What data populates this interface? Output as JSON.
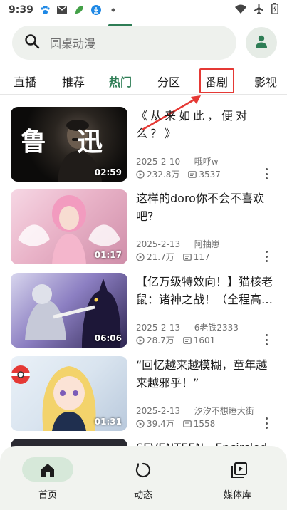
{
  "status_bar": {
    "time": "9:39"
  },
  "search": {
    "placeholder": "圆桌动漫"
  },
  "tabs": [
    "直播",
    "推荐",
    "热门",
    "分区",
    "番剧",
    "影视"
  ],
  "active_tab": "热门",
  "cards": [
    {
      "title": "《从来如此，便对么？》",
      "duration": "02:59",
      "date": "2025-2-10",
      "author": "哦呼w",
      "views": "232.8万",
      "comments": "3537",
      "thumb_text": "鲁  迅"
    },
    {
      "title": "这样的doro你不会不喜欢吧?",
      "duration": "01:17",
      "date": "2025-2-13",
      "author": "阿抽崽",
      "views": "21.7万",
      "comments": "117"
    },
    {
      "title": "【亿万级特效向！】猫核老鼠：诸神之战！（全程高…",
      "duration": "06:06",
      "date": "2025-2-13",
      "author": "6老铁2333",
      "views": "28.7万",
      "comments": "1601"
    },
    {
      "title": "“回忆越来越模糊，童年越来越邪乎！”",
      "duration": "01:31",
      "date": "2025-2-13",
      "author": "汐汐不想睡大街",
      "views": "39.4万",
      "comments": "1558"
    },
    {
      "title": "SEVENTEEN - Encircled",
      "duration": "",
      "date": "",
      "author": "",
      "views": "",
      "comments": ""
    }
  ],
  "bottom_nav": [
    {
      "label": "首页",
      "icon": "home-icon",
      "active": true
    },
    {
      "label": "动态",
      "icon": "refresh-circle-icon",
      "active": false
    },
    {
      "label": "媒体库",
      "icon": "media-library-icon",
      "active": false
    }
  ],
  "colors": {
    "accent": "#2e7d55",
    "highlight": "#e53935",
    "nav_bg": "#f1f3ef"
  }
}
